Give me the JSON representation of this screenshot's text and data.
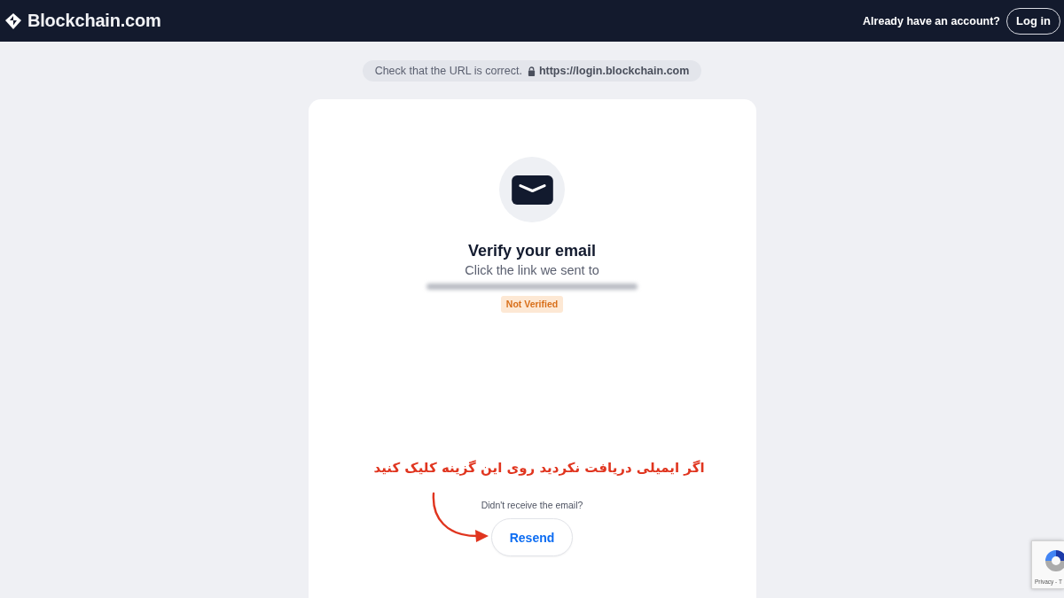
{
  "header": {
    "logo": "Blockchain.com",
    "prompt": "Already have an account?",
    "login_button": "Log in"
  },
  "url_notice": {
    "text": "Check that the URL is correct.",
    "url": "https://login.blockchain.com"
  },
  "card": {
    "title": "Verify your email",
    "subtitle": "Click the link we sent to",
    "status_badge": "Not Verified",
    "resend_prompt": "Didn't receive the email?",
    "resend_button": "Resend"
  },
  "annotation": {
    "text": "اگر ایمیلی دریافت نکردید روی این گزینه کلیک کنید"
  },
  "recaptcha": {
    "text": "Privacy - T"
  }
}
